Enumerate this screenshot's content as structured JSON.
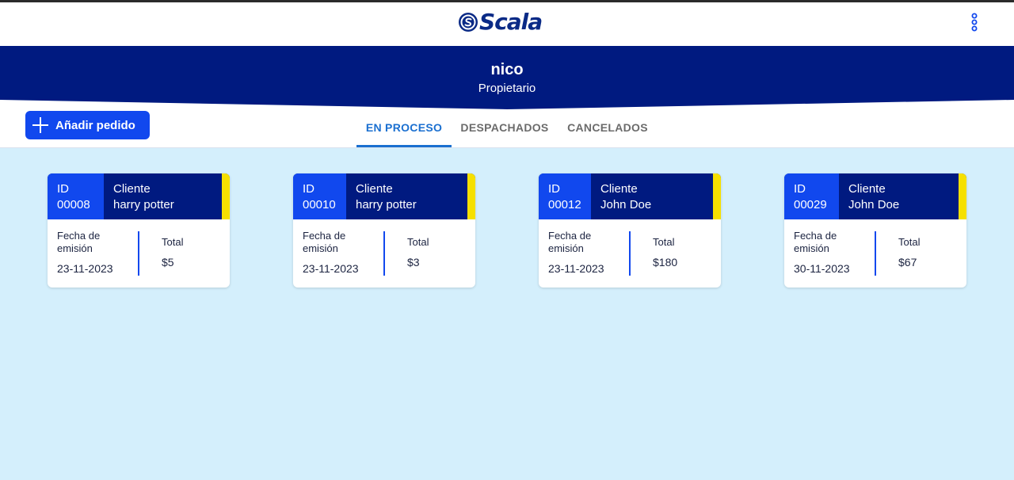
{
  "app": {
    "logo_text": "Scala"
  },
  "user": {
    "name": "nico",
    "role": "Propietario"
  },
  "actions": {
    "add_order_label": "Añadir pedido"
  },
  "tabs": [
    {
      "label": "EN PROCESO",
      "active": true
    },
    {
      "label": "DESPACHADOS",
      "active": false
    },
    {
      "label": "CANCELADOS",
      "active": false
    }
  ],
  "orders": [
    {
      "id_label": "ID",
      "id": "00008",
      "client_label": "Cliente",
      "client": "harry potter",
      "date_label": "Fecha de emisión",
      "date": "23-11-2023",
      "total_label": "Total",
      "total": "$5"
    },
    {
      "id_label": "ID",
      "id": "00010",
      "client_label": "Cliente",
      "client": "harry potter",
      "date_label": "Fecha de emisión",
      "date": "23-11-2023",
      "total_label": "Total",
      "total": "$3"
    },
    {
      "id_label": "ID",
      "id": "00012",
      "client_label": "Cliente",
      "client": "John Doe",
      "date_label": "Fecha de emisión",
      "date": "23-11-2023",
      "total_label": "Total",
      "total": "$180"
    },
    {
      "id_label": "ID",
      "id": "00029",
      "client_label": "Cliente",
      "client": "John Doe",
      "date_label": "Fecha de emisión",
      "date": "30-11-2023",
      "total_label": "Total",
      "total": "$67"
    }
  ],
  "colors": {
    "primary": "#1148ee",
    "navy": "#001a80",
    "accent_yellow": "#f6e000",
    "tab_active": "#1a6fd0",
    "background": "#d4effc"
  }
}
